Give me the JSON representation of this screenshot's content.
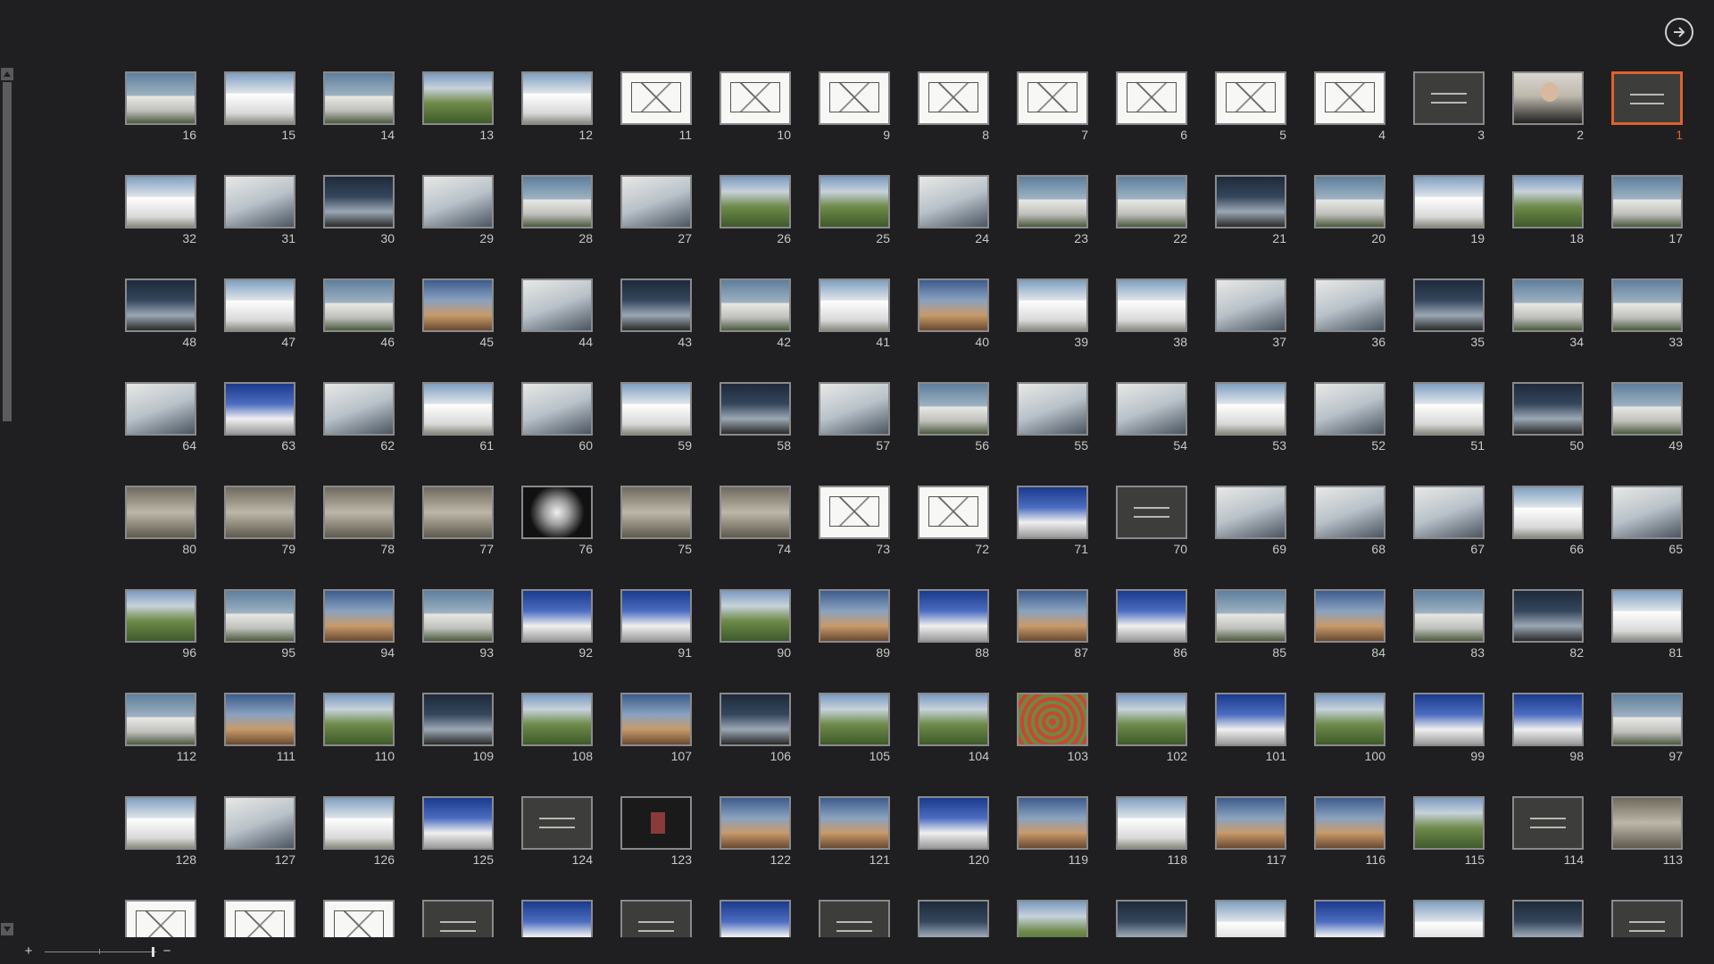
{
  "icons": {
    "exit": "arrow-right-circle-icon",
    "scroll_up": "triangle-up-icon",
    "scroll_down": "triangle-down-icon"
  },
  "colors": {
    "background": "#1f1f21",
    "selection": "#e0622c",
    "number_text": "#c8c8c8"
  },
  "zoom": {
    "in_label": "+",
    "out_label": "−",
    "level": 0.95
  },
  "scrollbar": {
    "position": 0.0,
    "visible_fraction": 0.4
  },
  "selected_slide": "1",
  "slides": [
    {
      "n": "16",
      "kind": "photo-sky"
    },
    {
      "n": "15",
      "kind": "photo-bright"
    },
    {
      "n": "14",
      "kind": "photo-sky"
    },
    {
      "n": "13",
      "kind": "photo-garden"
    },
    {
      "n": "12",
      "kind": "photo-bright"
    },
    {
      "n": "11",
      "kind": "drawing"
    },
    {
      "n": "10",
      "kind": "drawing"
    },
    {
      "n": "9",
      "kind": "drawing"
    },
    {
      "n": "8",
      "kind": "drawing"
    },
    {
      "n": "7",
      "kind": "drawing"
    },
    {
      "n": "6",
      "kind": "drawing"
    },
    {
      "n": "5",
      "kind": "drawing"
    },
    {
      "n": "4",
      "kind": "drawing"
    },
    {
      "n": "3",
      "kind": "title"
    },
    {
      "n": "2",
      "kind": "person"
    },
    {
      "n": "1",
      "kind": "title"
    },
    {
      "n": "32",
      "kind": "photo-bright"
    },
    {
      "n": "31",
      "kind": "photo-interior"
    },
    {
      "n": "30",
      "kind": "photo-dark"
    },
    {
      "n": "29",
      "kind": "photo-interior"
    },
    {
      "n": "28",
      "kind": "photo-sky"
    },
    {
      "n": "27",
      "kind": "photo-interior"
    },
    {
      "n": "26",
      "kind": "photo-garden"
    },
    {
      "n": "25",
      "kind": "photo-garden"
    },
    {
      "n": "24",
      "kind": "photo-interior"
    },
    {
      "n": "23",
      "kind": "photo-sky"
    },
    {
      "n": "22",
      "kind": "photo-sky"
    },
    {
      "n": "21",
      "kind": "photo-dark"
    },
    {
      "n": "20",
      "kind": "photo-sky"
    },
    {
      "n": "19",
      "kind": "photo-bright"
    },
    {
      "n": "18",
      "kind": "photo-garden"
    },
    {
      "n": "17",
      "kind": "photo-sky"
    },
    {
      "n": "48",
      "kind": "photo-dark"
    },
    {
      "n": "47",
      "kind": "photo-bright"
    },
    {
      "n": "46",
      "kind": "photo-sky"
    },
    {
      "n": "45",
      "kind": "photo-warm"
    },
    {
      "n": "44",
      "kind": "photo-interior"
    },
    {
      "n": "43",
      "kind": "photo-dark"
    },
    {
      "n": "42",
      "kind": "photo-sky"
    },
    {
      "n": "41",
      "kind": "photo-bright"
    },
    {
      "n": "40",
      "kind": "photo-warm"
    },
    {
      "n": "39",
      "kind": "photo-bright"
    },
    {
      "n": "38",
      "kind": "photo-bright"
    },
    {
      "n": "37",
      "kind": "photo-interior"
    },
    {
      "n": "36",
      "kind": "photo-interior"
    },
    {
      "n": "35",
      "kind": "photo-dark"
    },
    {
      "n": "34",
      "kind": "photo-sky"
    },
    {
      "n": "33",
      "kind": "photo-sky"
    },
    {
      "n": "64",
      "kind": "photo-interior"
    },
    {
      "n": "63",
      "kind": "photo-blue"
    },
    {
      "n": "62",
      "kind": "photo-interior"
    },
    {
      "n": "61",
      "kind": "photo-bright"
    },
    {
      "n": "60",
      "kind": "photo-interior"
    },
    {
      "n": "59",
      "kind": "photo-bright"
    },
    {
      "n": "58",
      "kind": "photo-dark"
    },
    {
      "n": "57",
      "kind": "photo-interior"
    },
    {
      "n": "56",
      "kind": "photo-sky"
    },
    {
      "n": "55",
      "kind": "photo-interior"
    },
    {
      "n": "54",
      "kind": "photo-interior"
    },
    {
      "n": "53",
      "kind": "photo-bright"
    },
    {
      "n": "52",
      "kind": "photo-interior"
    },
    {
      "n": "51",
      "kind": "photo-bright"
    },
    {
      "n": "50",
      "kind": "photo-dark"
    },
    {
      "n": "49",
      "kind": "photo-sky"
    },
    {
      "n": "80",
      "kind": "photo-aerial"
    },
    {
      "n": "79",
      "kind": "photo-aerial"
    },
    {
      "n": "78",
      "kind": "photo-aerial"
    },
    {
      "n": "77",
      "kind": "photo-aerial"
    },
    {
      "n": "76",
      "kind": "photo-night"
    },
    {
      "n": "75",
      "kind": "photo-aerial"
    },
    {
      "n": "74",
      "kind": "photo-aerial"
    },
    {
      "n": "73",
      "kind": "drawing"
    },
    {
      "n": "72",
      "kind": "drawing"
    },
    {
      "n": "71",
      "kind": "photo-blue"
    },
    {
      "n": "70",
      "kind": "title"
    },
    {
      "n": "69",
      "kind": "photo-interior"
    },
    {
      "n": "68",
      "kind": "photo-interior"
    },
    {
      "n": "67",
      "kind": "photo-interior"
    },
    {
      "n": "66",
      "kind": "photo-bright"
    },
    {
      "n": "65",
      "kind": "photo-interior"
    },
    {
      "n": "96",
      "kind": "photo-garden"
    },
    {
      "n": "95",
      "kind": "photo-sky"
    },
    {
      "n": "94",
      "kind": "photo-warm"
    },
    {
      "n": "93",
      "kind": "photo-sky"
    },
    {
      "n": "92",
      "kind": "photo-blue"
    },
    {
      "n": "91",
      "kind": "photo-blue"
    },
    {
      "n": "90",
      "kind": "photo-garden"
    },
    {
      "n": "89",
      "kind": "photo-warm"
    },
    {
      "n": "88",
      "kind": "photo-blue"
    },
    {
      "n": "87",
      "kind": "photo-warm"
    },
    {
      "n": "86",
      "kind": "photo-blue"
    },
    {
      "n": "85",
      "kind": "photo-sky"
    },
    {
      "n": "84",
      "kind": "photo-warm"
    },
    {
      "n": "83",
      "kind": "photo-sky"
    },
    {
      "n": "82",
      "kind": "photo-dark"
    },
    {
      "n": "81",
      "kind": "photo-bright"
    },
    {
      "n": "112",
      "kind": "photo-sky"
    },
    {
      "n": "111",
      "kind": "photo-warm"
    },
    {
      "n": "110",
      "kind": "photo-garden"
    },
    {
      "n": "109",
      "kind": "photo-dark"
    },
    {
      "n": "108",
      "kind": "photo-garden"
    },
    {
      "n": "107",
      "kind": "photo-warm"
    },
    {
      "n": "106",
      "kind": "photo-dark"
    },
    {
      "n": "105",
      "kind": "photo-garden"
    },
    {
      "n": "104",
      "kind": "photo-garden"
    },
    {
      "n": "103",
      "kind": "photo-maze"
    },
    {
      "n": "102",
      "kind": "photo-garden"
    },
    {
      "n": "101",
      "kind": "photo-blue"
    },
    {
      "n": "100",
      "kind": "photo-garden"
    },
    {
      "n": "99",
      "kind": "photo-blue"
    },
    {
      "n": "98",
      "kind": "photo-blue"
    },
    {
      "n": "97",
      "kind": "photo-sky"
    },
    {
      "n": "128",
      "kind": "photo-bright"
    },
    {
      "n": "127",
      "kind": "photo-interior"
    },
    {
      "n": "126",
      "kind": "photo-bright"
    },
    {
      "n": "125",
      "kind": "photo-blue"
    },
    {
      "n": "124",
      "kind": "title"
    },
    {
      "n": "123",
      "kind": "black"
    },
    {
      "n": "122",
      "kind": "photo-warm"
    },
    {
      "n": "121",
      "kind": "photo-warm"
    },
    {
      "n": "120",
      "kind": "photo-blue"
    },
    {
      "n": "119",
      "kind": "photo-warm"
    },
    {
      "n": "118",
      "kind": "photo-bright"
    },
    {
      "n": "117",
      "kind": "photo-warm"
    },
    {
      "n": "116",
      "kind": "photo-warm"
    },
    {
      "n": "115",
      "kind": "photo-garden"
    },
    {
      "n": "114",
      "kind": "title"
    },
    {
      "n": "113",
      "kind": "photo-aerial"
    },
    {
      "n": "",
      "kind": "drawing"
    },
    {
      "n": "",
      "kind": "drawing"
    },
    {
      "n": "",
      "kind": "drawing"
    },
    {
      "n": "",
      "kind": "title"
    },
    {
      "n": "",
      "kind": "photo-blue"
    },
    {
      "n": "",
      "kind": "title"
    },
    {
      "n": "",
      "kind": "photo-blue"
    },
    {
      "n": "",
      "kind": "title"
    },
    {
      "n": "",
      "kind": "photo-dark"
    },
    {
      "n": "",
      "kind": "photo-garden"
    },
    {
      "n": "",
      "kind": "photo-dark"
    },
    {
      "n": "",
      "kind": "photo-bright"
    },
    {
      "n": "",
      "kind": "photo-blue"
    },
    {
      "n": "",
      "kind": "photo-bright"
    },
    {
      "n": "",
      "kind": "photo-dark"
    },
    {
      "n": "",
      "kind": "title"
    }
  ]
}
